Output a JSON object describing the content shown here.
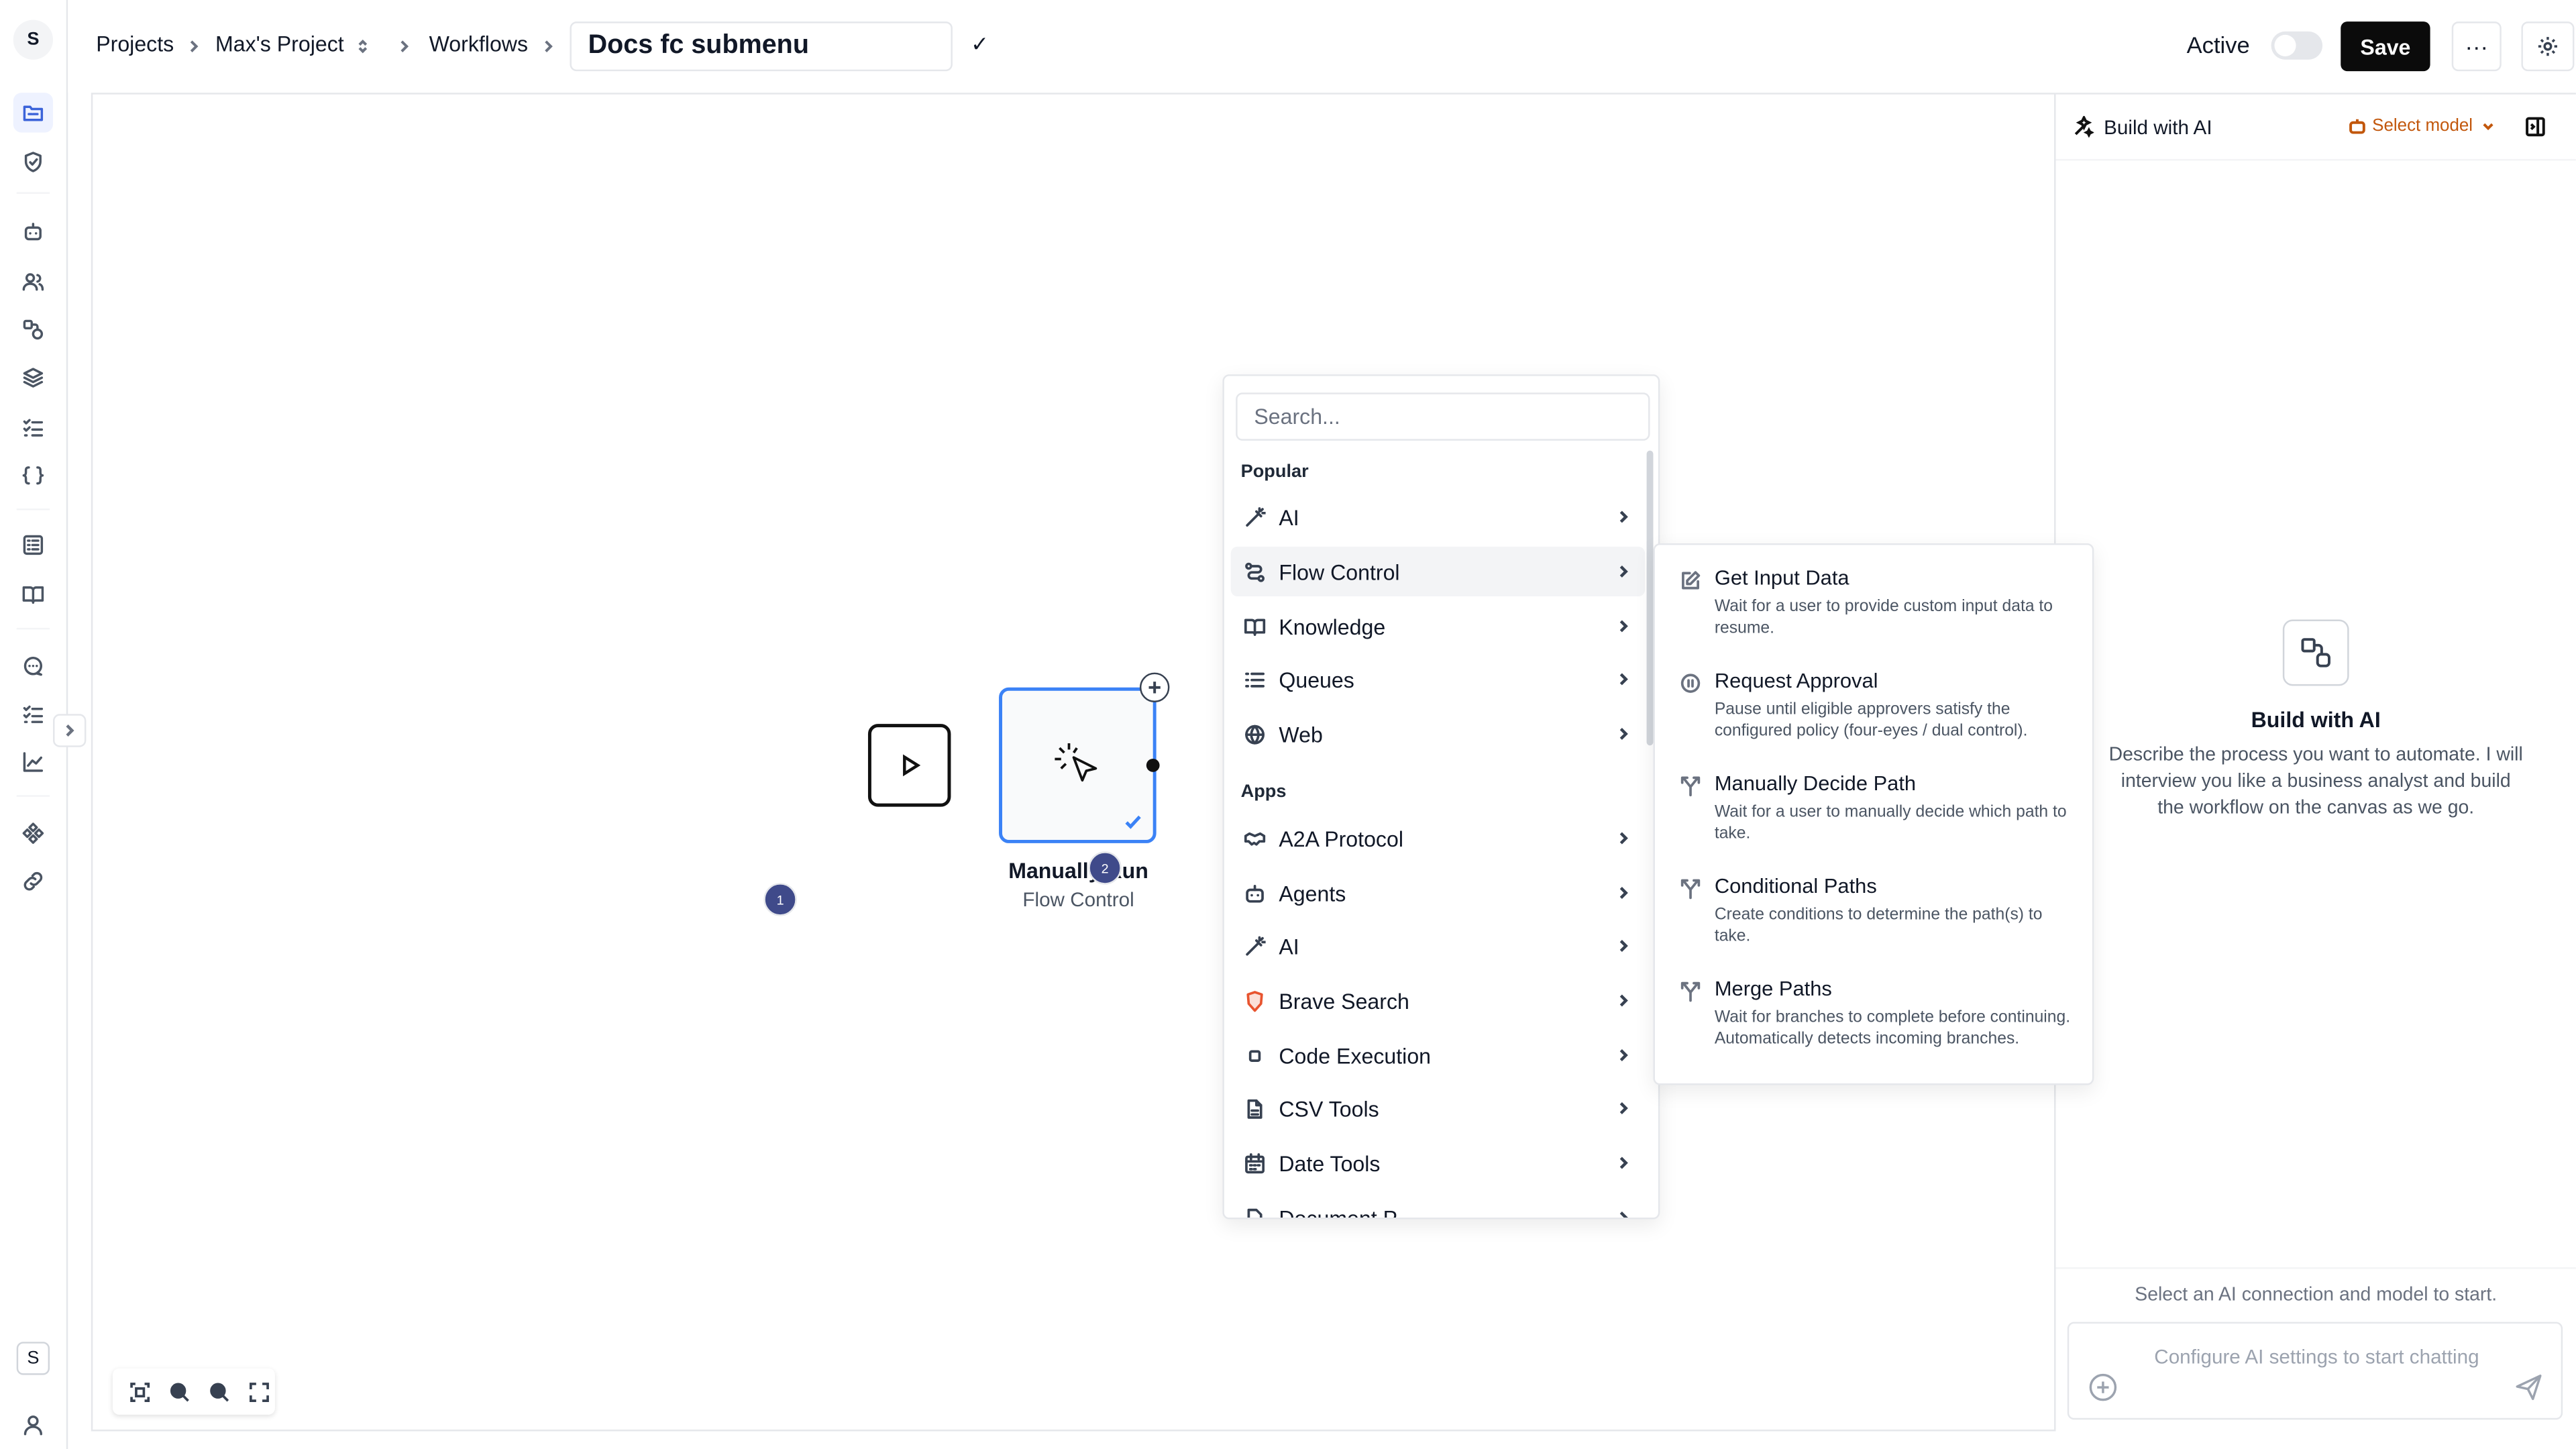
{
  "rail": {
    "logo": "S",
    "workspace_badge": "S"
  },
  "topbar": {
    "breadcrumb": [
      "Projects",
      "Max's Project",
      "Workflows"
    ],
    "workflow_title": "Docs fc submenu",
    "confirm_glyph": "✓",
    "active_label": "Active",
    "active_toggle_on": false,
    "save_label": "Save",
    "more_glyph": "···"
  },
  "canvas": {
    "node_title": "Manually Run",
    "node_subtitle": "Flow Control",
    "badge_1": "1",
    "badge_2": "2"
  },
  "dropdown": {
    "search_placeholder": "Search...",
    "popular_label": "Popular",
    "popular": [
      {
        "label": "AI",
        "icon": "magic-wand-icon"
      },
      {
        "label": "Flow Control",
        "icon": "flow-control-icon"
      },
      {
        "label": "Knowledge",
        "icon": "book-icon"
      },
      {
        "label": "Queues",
        "icon": "list-icon"
      },
      {
        "label": "Web",
        "icon": "globe-icon"
      }
    ],
    "apps_label": "Apps",
    "apps": [
      {
        "label": "A2A Protocol",
        "icon": "handshake-icon"
      },
      {
        "label": "Agents",
        "icon": "robot-icon"
      },
      {
        "label": "AI",
        "icon": "magic-wand-icon"
      },
      {
        "label": "Brave Search",
        "icon": "brave-shield-icon"
      },
      {
        "label": "Code Execution",
        "icon": "square-icon"
      },
      {
        "label": "CSV Tools",
        "icon": "file-icon"
      },
      {
        "label": "Date Tools",
        "icon": "calendar-icon"
      },
      {
        "label": "Document P...",
        "icon": "document-icon"
      }
    ]
  },
  "submenu": {
    "items": [
      {
        "title": "Get Input Data",
        "desc": "Wait for a user to provide custom input data to resume."
      },
      {
        "title": "Request Approval",
        "desc": "Pause until eligible approvers satisfy the configured policy (four-eyes / dual control)."
      },
      {
        "title": "Manually Decide Path",
        "desc": "Wait for a user to manually decide which path to take."
      },
      {
        "title": "Conditional Paths",
        "desc": "Create conditions to determine the path(s) to take."
      },
      {
        "title": "Merge Paths",
        "desc": "Wait for branches to complete before continuing. Automatically detects incoming branches."
      }
    ]
  },
  "ai_panel": {
    "title": "Build with AI",
    "select_model": "Select model",
    "empty_title": "Build with AI",
    "empty_desc": "Describe the process you want to automate. I will interview you like a business analyst and build the workflow on the canvas as we go.",
    "status": "Select an AI connection and model to start.",
    "input_placeholder": "Configure AI settings to start chatting"
  },
  "colors": {
    "accent": "#3b82f6",
    "badge": "#3f4a8a",
    "model_link": "#c2570c",
    "save_bg": "#0b0b0b"
  }
}
